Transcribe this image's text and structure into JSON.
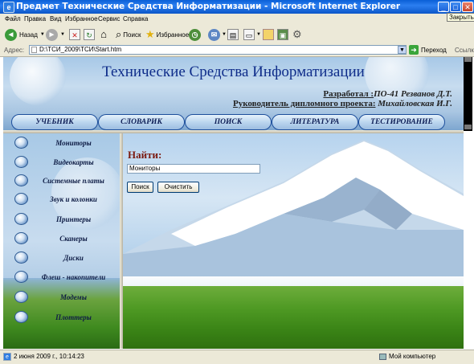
{
  "window": {
    "title": "Предмет Технические Средства Информатизации - Microsoft Internet Explorer",
    "min": "_",
    "max": "□",
    "close": "✕",
    "tooltip": "Закрыть"
  },
  "menu": [
    "Файл",
    "Правка",
    "Вид",
    "Избранное",
    "Сервис",
    "Справка"
  ],
  "toolbar": {
    "back": "Назад",
    "search": "Поиск",
    "favorites": "Избранное"
  },
  "address": {
    "label": "Адрес:",
    "value": "D:\\ТСИ_2009\\ТСИ\\Start.htm",
    "go": "Переход",
    "links": "Ссылки"
  },
  "header": {
    "title": "Технические Средства Информатизации",
    "developer_label": "Разработал :",
    "developer_value": "ПО-41 Резванов Д.Т.",
    "manager_label": "Руководитель дипломного проекта:",
    "manager_value": " Михайловская И.Г."
  },
  "nav": [
    "УЧЕБНИК",
    "СЛОВАРИК",
    "ПОИСК",
    "ЛИТЕРАТУРА",
    "ТЕСТИРОВАНИЕ"
  ],
  "sidebar": [
    "Мониторы",
    "Видеокарты",
    "Системные платы",
    "Звук и колонки",
    "Принтеры",
    "Сканеры",
    "Диски",
    "Флеш - накопители",
    "Модемы",
    "Плоттеры"
  ],
  "search": {
    "title": "Найти:",
    "value": "Мониторы",
    "search_btn": "Поиск",
    "clear_btn": "Очистить"
  },
  "status": {
    "text": "2 июня 2009 г., 10:14:23",
    "zone": "Мой компьютер"
  }
}
